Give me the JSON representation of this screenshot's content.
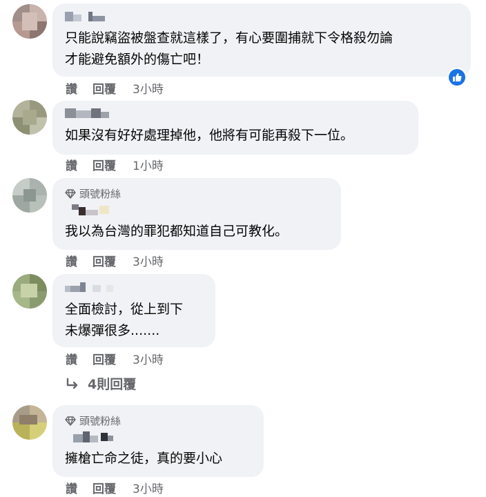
{
  "comments": [
    {
      "lines": [
        "只能說竊盜被盤查就這樣了，有心要圍捕就下令格殺勿論",
        "才能避免額外的傷亡吧！"
      ],
      "actions": {
        "like": "讚",
        "reply": "回覆",
        "time": "3小時"
      }
    },
    {
      "lines": [
        "如果沒有好好處理掉他，他將有可能再殺下一位。"
      ],
      "actions": {
        "like": "讚",
        "reply": "回覆",
        "time": "1小時"
      }
    },
    {
      "badge": "頭號粉絲",
      "lines": [
        "我以為台灣的罪犯都知道自己可教化。"
      ],
      "actions": {
        "like": "讚",
        "reply": "回覆",
        "time": "3小時"
      }
    },
    {
      "lines": [
        "全面檢討，從上到下",
        "未爆彈很多......."
      ],
      "actions": {
        "like": "讚",
        "reply": "回覆",
        "time": "3小時"
      }
    },
    {
      "badge": "頭號粉絲",
      "lines": [
        "擁槍亡命之徒，真的要小心"
      ],
      "actions": {
        "like": "讚",
        "reply": "回覆",
        "time": "3小時"
      }
    }
  ],
  "view_replies": "4則回覆",
  "icons": {
    "reaction": "like-reaction-icon",
    "badge": "diamond-icon",
    "replies": "reply-arrow-icon"
  },
  "colors": {
    "bubble": "#f0f2f5",
    "secondary_text": "#65676b",
    "like_blue": "#1b74e4"
  }
}
